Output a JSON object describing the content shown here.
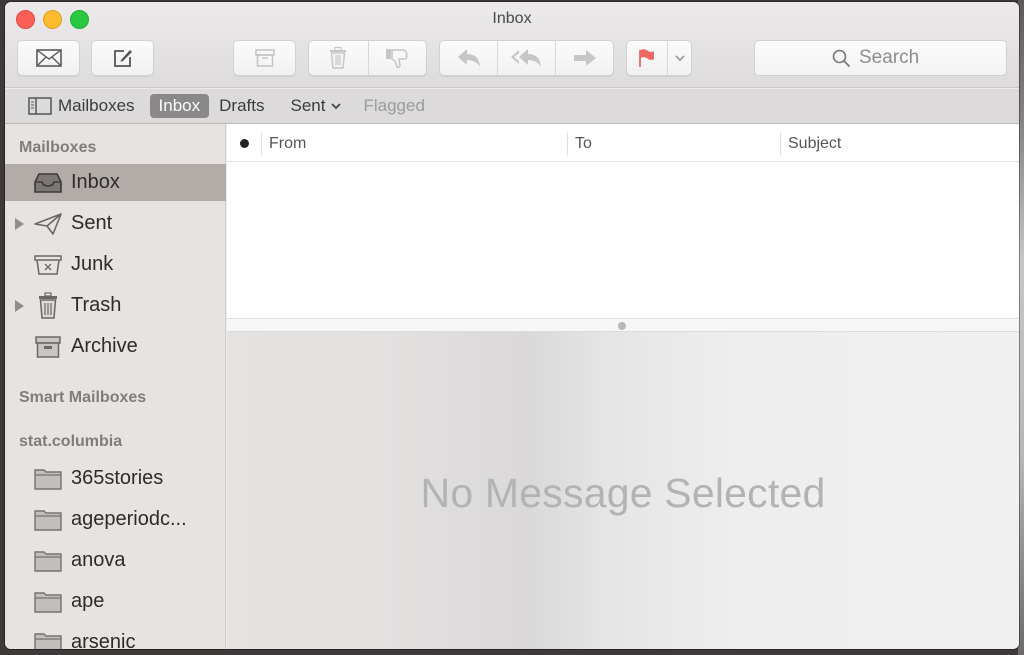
{
  "window": {
    "title": "Inbox"
  },
  "toolbar": {
    "get_mail": "envelope-icon",
    "compose": "compose-icon",
    "archive": "archive-icon",
    "delete": "trash-icon",
    "junk": "thumbs-down-icon",
    "reply": "reply-icon",
    "reply_all": "reply-all-icon",
    "forward": "forward-icon",
    "flag": "flag-icon",
    "flag_menu": "chevron-down-icon",
    "search_placeholder": "Search",
    "flag_color": "#e8453c"
  },
  "favorites": {
    "mailboxes_label": "Mailboxes",
    "items": [
      {
        "label": "Inbox",
        "active": true
      },
      {
        "label": "Drafts"
      },
      {
        "label": "Sent",
        "has_menu": true
      },
      {
        "label": "Flagged",
        "disabled": true
      }
    ]
  },
  "sidebar": {
    "mailboxes_heading": "Mailboxes",
    "mailboxes": [
      {
        "label": "Inbox",
        "icon": "inbox-icon",
        "selected": true
      },
      {
        "label": "Sent",
        "icon": "paper-plane-icon",
        "expandable": true
      },
      {
        "label": "Junk",
        "icon": "junk-icon"
      },
      {
        "label": "Trash",
        "icon": "trash-icon",
        "expandable": true
      },
      {
        "label": "Archive",
        "icon": "archive-icon"
      }
    ],
    "smart_heading": "Smart Mailboxes",
    "account_heading": "stat.columbia",
    "folders": [
      {
        "label": "365stories"
      },
      {
        "label": "ageperiodc..."
      },
      {
        "label": "anova"
      },
      {
        "label": "ape"
      },
      {
        "label": "arsenic"
      }
    ]
  },
  "message_list": {
    "columns": [
      "From",
      "To",
      "Subject"
    ]
  },
  "preview": {
    "empty_text": "No Message Selected"
  }
}
